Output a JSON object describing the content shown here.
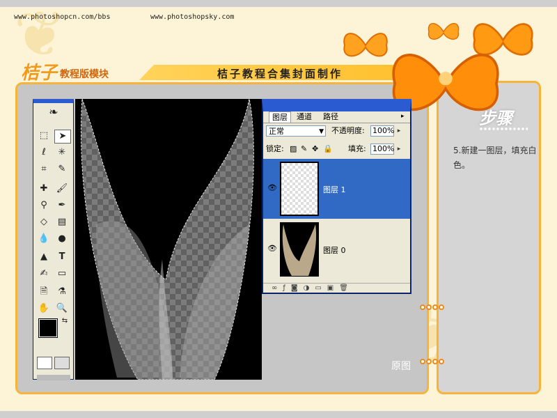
{
  "header": {
    "url_left": "www.photoshopcn.com/bbs",
    "url_right": "www.photoshopsky.com",
    "brand": "桔子",
    "brand_sub": "教程版模块",
    "title": "桔子教程合集封面制作"
  },
  "steps": {
    "heading": "步骤",
    "text": "5.新建一图层，填充白色。"
  },
  "layers_panel": {
    "tabs": [
      "图层",
      "通道",
      "路径"
    ],
    "blend_mode": "正常",
    "opacity_label": "不透明度:",
    "opacity_value": "100%",
    "lock_label": "锁定:",
    "fill_label": "填充:",
    "fill_value": "100%",
    "layers": [
      {
        "name": "图层 1",
        "selected": true
      },
      {
        "name": "图层 0",
        "selected": false
      }
    ]
  },
  "canvas_label": "原图",
  "colors": {
    "accent": "#f39a16",
    "selection": "#316ac5",
    "frame": "#f6b43b"
  }
}
